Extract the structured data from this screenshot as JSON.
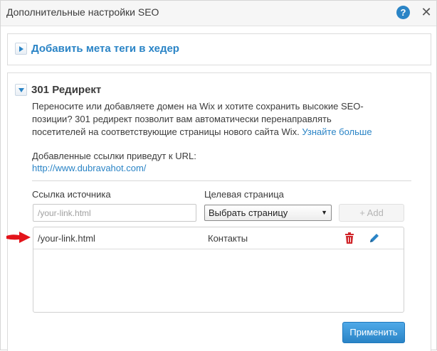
{
  "header": {
    "title": "Дополнительные настройки SEO",
    "help_label": "?",
    "close_label": "✕"
  },
  "meta_section": {
    "title": "Добавить мета теги в хедер"
  },
  "redirect_section": {
    "title": "301 Редирект",
    "description_lines": [
      "Переносите или добавляете домен на Wix и хотите сохранить высокие SEO-",
      "позиции? 301 редирект позволит вам автоматически перенаправлять",
      "посетителей на соответствующие страницы нового сайта Wix."
    ],
    "learn_more": "Узнайте больше",
    "note": "Добавленные ссылки приведут к URL:",
    "site_url": "http://www.dubravahot.com/",
    "source_label": "Ссылка источника",
    "target_label": "Целевая страница",
    "source_placeholder": "/your-link.html",
    "select_value": "Выбрать страницу",
    "add_button": "+ Add",
    "rows": [
      {
        "source": "/your-link.html",
        "target": "Контакты"
      }
    ],
    "apply_button": "Применить"
  },
  "colors": {
    "accent": "#2a84c6",
    "delete_icon": "#d0262b",
    "arrow_marker": "#e3141b"
  },
  "icons": {
    "help": "help-icon",
    "close": "close-icon",
    "expand_right": "triangle-right-icon",
    "expand_down": "triangle-down-icon",
    "delete": "trash-icon",
    "edit": "pencil-icon",
    "marker": "red-arrow-icon"
  }
}
